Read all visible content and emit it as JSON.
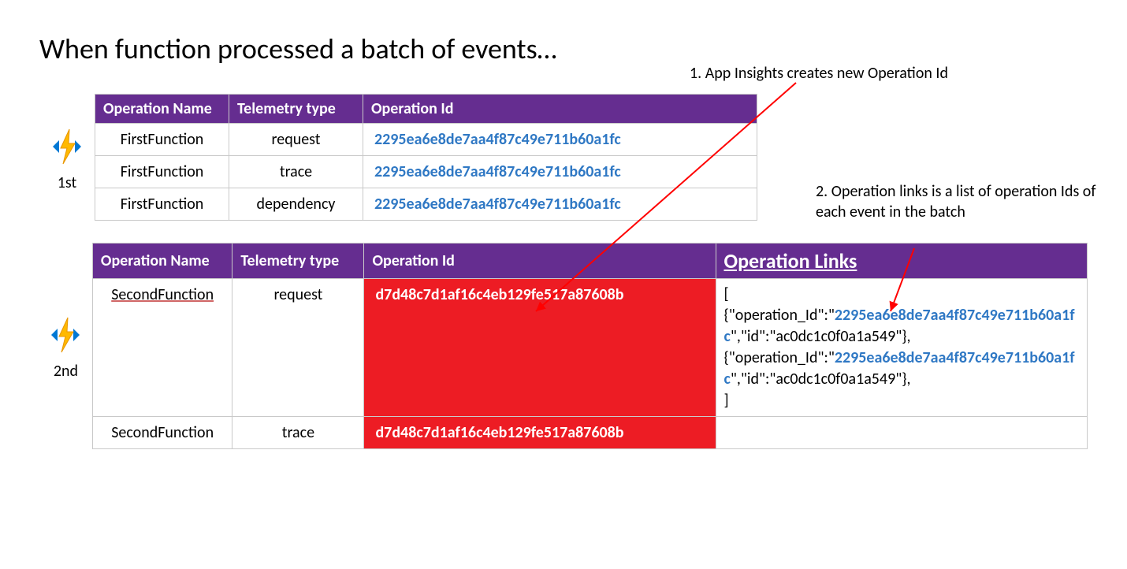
{
  "title": "When function processed a batch of events…",
  "annotations": {
    "a1": "1. App Insights creates new Operation Id",
    "a2": "2. Operation links is a list of operation Ids of each event in the batch"
  },
  "labels": {
    "first": "1st",
    "second": "2nd"
  },
  "table1": {
    "headers": [
      "Operation Name",
      "Telemetry type",
      "Operation Id"
    ],
    "rows": [
      {
        "name": "FirstFunction",
        "type": "request",
        "opid": "2295ea6e8de7aa4f87c49e711b60a1fc"
      },
      {
        "name": "FirstFunction",
        "type": "trace",
        "opid": "2295ea6e8de7aa4f87c49e711b60a1fc"
      },
      {
        "name": "FirstFunction",
        "type": "dependency",
        "opid": "2295ea6e8de7aa4f87c49e711b60a1fc"
      }
    ]
  },
  "table2": {
    "headers": [
      "Operation Name",
      "Telemetry type",
      "Operation Id",
      "Operation Links"
    ],
    "rows": [
      {
        "name": "SecondFunction",
        "type": "request",
        "opid": "d7d48c7d1af16c4eb129fe517a87608b"
      },
      {
        "name": "SecondFunction",
        "type": "trace",
        "opid": "d7d48c7d1af16c4eb129fe517a87608b"
      }
    ],
    "links_json": {
      "open": "[",
      "close": "]",
      "entries": [
        {
          "opid": "2295ea6e8de7aa4f87c49e711b60a1fc",
          "id": "ac0dc1c0f0a1a549"
        },
        {
          "opid": "2295ea6e8de7aa4f87c49e711b60a1fc",
          "id": "ac0dc1c0f0a1a549"
        }
      ]
    }
  }
}
